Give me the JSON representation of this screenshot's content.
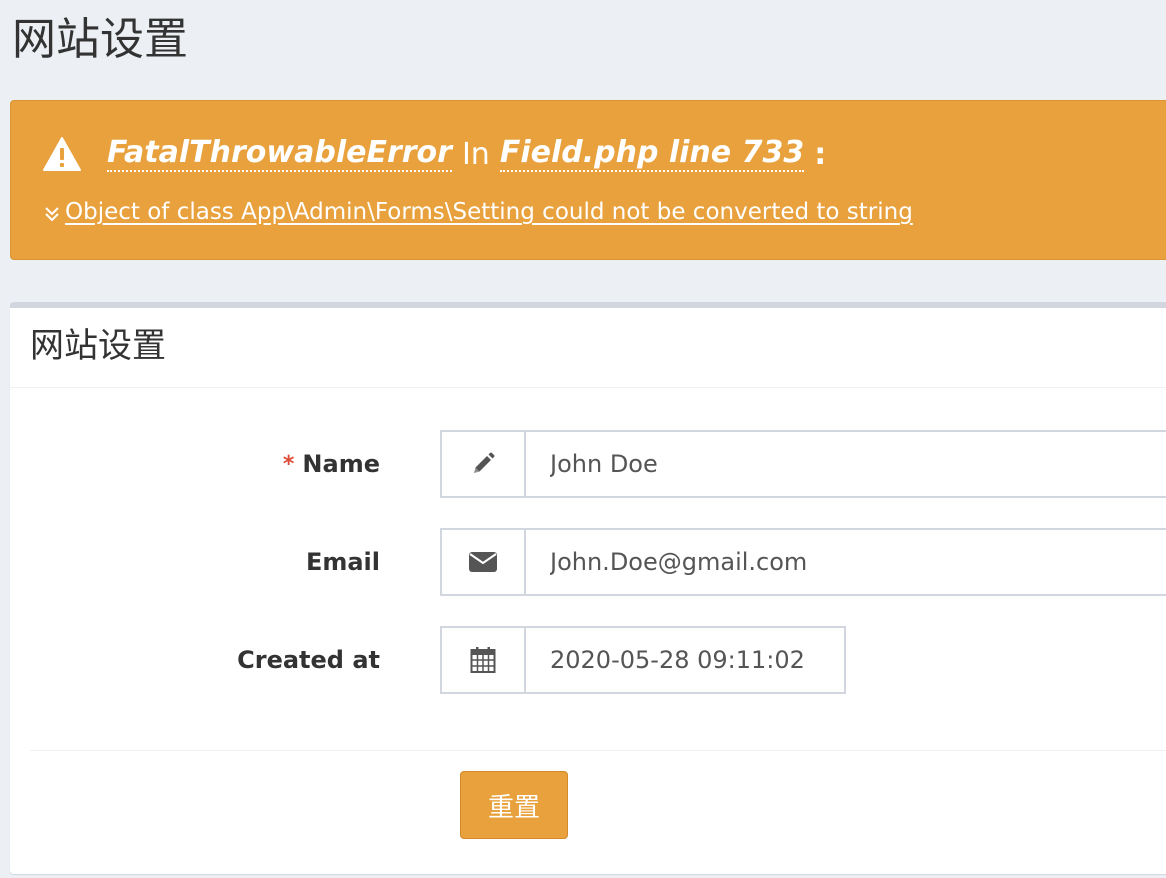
{
  "page": {
    "title": "网站设置"
  },
  "error": {
    "exception": "FatalThrowableError",
    "in_text": "In",
    "location": "Field.php line 733",
    "colon": ":",
    "message": " Object of class App\\Admin\\Forms\\Setting could not be converted to string",
    "icons": [
      "warning-icon",
      "double-chevron-down-icon"
    ]
  },
  "box": {
    "title": "网站设置"
  },
  "form": {
    "fields": [
      {
        "label": "Name",
        "required": true,
        "required_mark": "*",
        "icon": "pencil-icon",
        "value": "John Doe"
      },
      {
        "label": "Email",
        "required": false,
        "icon": "envelope-icon",
        "value": "John.Doe@gmail.com"
      },
      {
        "label": "Created at",
        "required": false,
        "icon": "calendar-icon",
        "value": "2020-05-28 09:11:02"
      }
    ],
    "reset_label": "重置"
  },
  "colors": {
    "warning": "#e8a13c",
    "background": "#ecf0f5",
    "required": "#dd4b39",
    "border": "#d2d6de"
  }
}
